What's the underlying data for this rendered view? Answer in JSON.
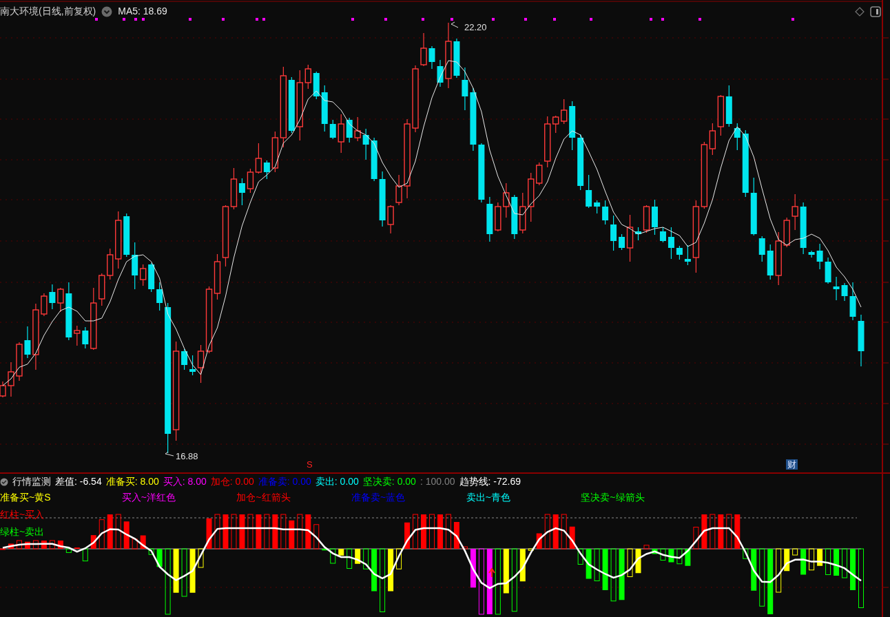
{
  "chart": {
    "title": "南大环境(日线,前复权)",
    "ma_label": "MA5: 18.69",
    "high_label": "22.20",
    "low_label": "16.88",
    "signal_mark": "S",
    "finance_badge": "财"
  },
  "indicator": {
    "name": "行情监测",
    "values": [
      {
        "text": "差值: -6.54",
        "color": "#ffffff"
      },
      {
        "text": "准备买: 8.00",
        "color": "#ffff00"
      },
      {
        "text": "买入: 8.00",
        "color": "#ff00ff"
      },
      {
        "text": "加仓: 0.00",
        "color": "#ff0000"
      },
      {
        "text": "准备卖: 0.00",
        "color": "#0000ff"
      },
      {
        "text": "卖出: 0.00",
        "color": "#00ffff"
      },
      {
        "text": "坚决卖: 0.00",
        "color": "#00ff00"
      },
      {
        "text": ": 100.00",
        "color": "#808080"
      },
      {
        "text": "趋势线: -72.69",
        "color": "#ffffff"
      }
    ],
    "legend": [
      {
        "text": "准备买~黄S",
        "color": "#ffff00"
      },
      {
        "text": "买入~洋红色",
        "color": "#ff00ff"
      },
      {
        "text": "加仓~红箭头",
        "color": "#ff0000"
      },
      {
        "text": "准备卖~蓝色",
        "color": "#0000ff"
      },
      {
        "text": "卖出~青色",
        "color": "#00ffff"
      },
      {
        "text": "坚决卖~绿箭头",
        "color": "#00ff00"
      }
    ],
    "bar_legend": [
      {
        "text": "红柱~买入",
        "color": "#ff0000"
      },
      {
        "text": "绿柱~卖出",
        "color": "#00ff00"
      }
    ]
  }
}
